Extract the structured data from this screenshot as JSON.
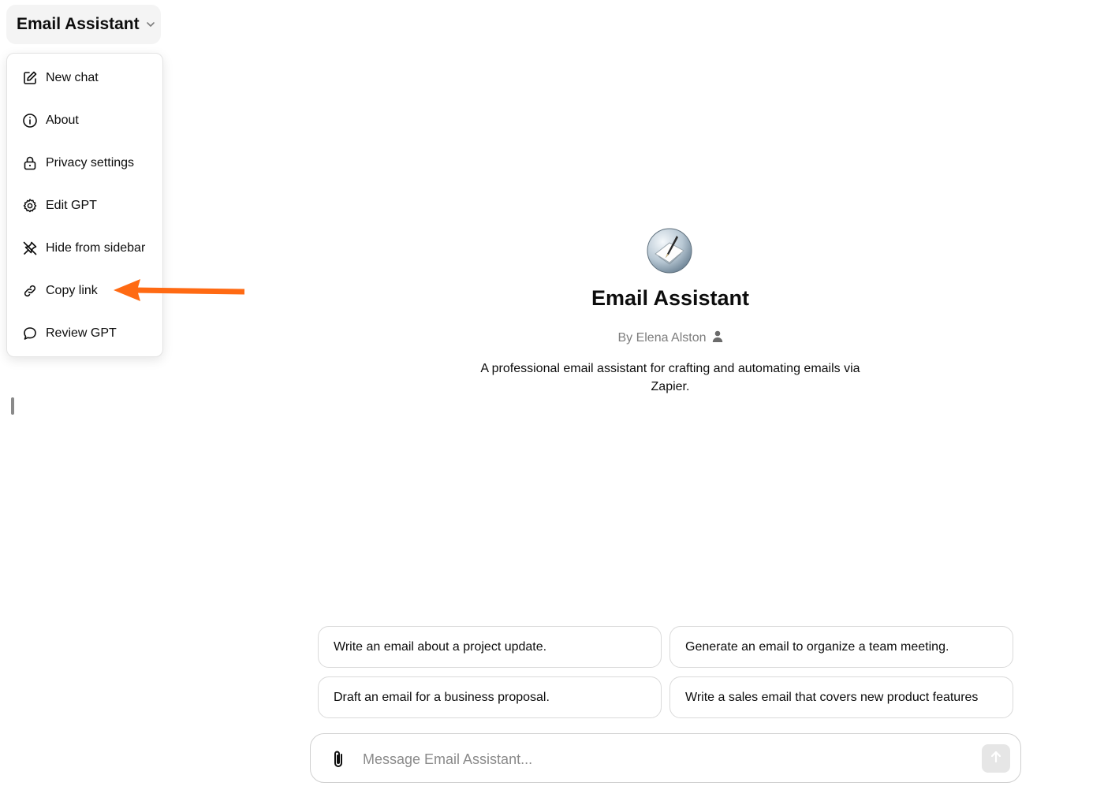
{
  "header": {
    "title": "Email Assistant",
    "chevron_icon": "chevron-down-icon"
  },
  "menu": {
    "items": [
      {
        "label": "New chat",
        "icon": "edit-icon"
      },
      {
        "label": "About",
        "icon": "info-icon"
      },
      {
        "label": "Privacy settings",
        "icon": "lock-icon"
      },
      {
        "label": "Edit GPT",
        "icon": "gear-icon"
      },
      {
        "label": "Hide from sidebar",
        "icon": "unpin-icon"
      },
      {
        "label": "Copy link",
        "icon": "link-icon"
      },
      {
        "label": "Review GPT",
        "icon": "chat-bubble-icon"
      }
    ]
  },
  "annotation": {
    "arrow_color": "#ff6a13",
    "points_to": "Copy link"
  },
  "profile": {
    "name": "Email Assistant",
    "byline": "By Elena Alston",
    "description": "A professional email assistant for crafting and automating emails via Zapier."
  },
  "suggestions": [
    "Write an email about a project update.",
    "Generate an email to organize a team meeting.",
    "Draft an email for a business proposal.",
    "Write a sales email that covers new product features"
  ],
  "composer": {
    "placeholder": "Message Email Assistant..."
  },
  "colors": {
    "accent_arrow": "#ff6a13",
    "text": "#0d0d0d",
    "muted": "#7d7d7d",
    "border": "#dadada"
  }
}
